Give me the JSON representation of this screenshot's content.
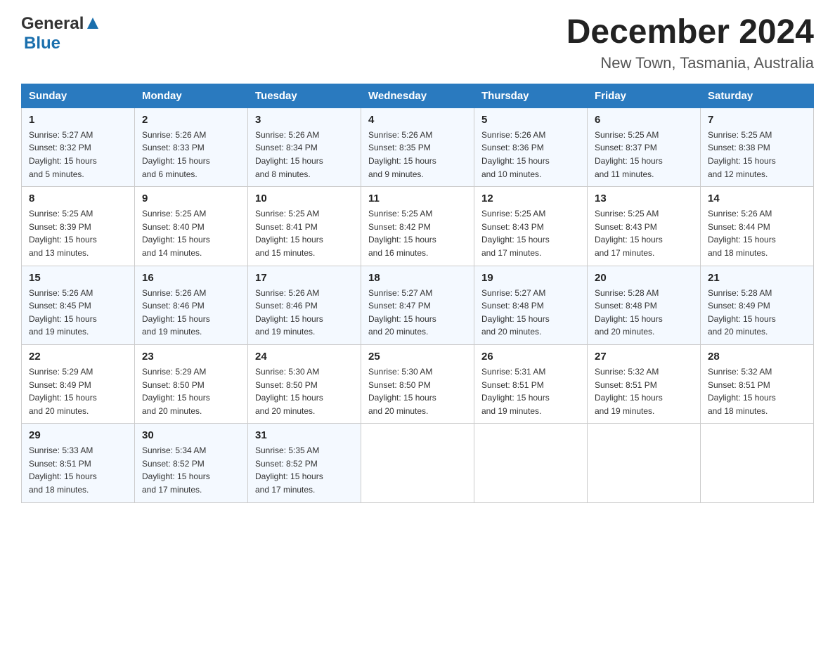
{
  "header": {
    "logo_general": "General",
    "logo_blue": "Blue",
    "month_title": "December 2024",
    "location": "New Town, Tasmania, Australia"
  },
  "days_of_week": [
    "Sunday",
    "Monday",
    "Tuesday",
    "Wednesday",
    "Thursday",
    "Friday",
    "Saturday"
  ],
  "weeks": [
    [
      {
        "day": "1",
        "sunrise": "5:27 AM",
        "sunset": "8:32 PM",
        "daylight": "15 hours and 5 minutes."
      },
      {
        "day": "2",
        "sunrise": "5:26 AM",
        "sunset": "8:33 PM",
        "daylight": "15 hours and 6 minutes."
      },
      {
        "day": "3",
        "sunrise": "5:26 AM",
        "sunset": "8:34 PM",
        "daylight": "15 hours and 8 minutes."
      },
      {
        "day": "4",
        "sunrise": "5:26 AM",
        "sunset": "8:35 PM",
        "daylight": "15 hours and 9 minutes."
      },
      {
        "day": "5",
        "sunrise": "5:26 AM",
        "sunset": "8:36 PM",
        "daylight": "15 hours and 10 minutes."
      },
      {
        "day": "6",
        "sunrise": "5:25 AM",
        "sunset": "8:37 PM",
        "daylight": "15 hours and 11 minutes."
      },
      {
        "day": "7",
        "sunrise": "5:25 AM",
        "sunset": "8:38 PM",
        "daylight": "15 hours and 12 minutes."
      }
    ],
    [
      {
        "day": "8",
        "sunrise": "5:25 AM",
        "sunset": "8:39 PM",
        "daylight": "15 hours and 13 minutes."
      },
      {
        "day": "9",
        "sunrise": "5:25 AM",
        "sunset": "8:40 PM",
        "daylight": "15 hours and 14 minutes."
      },
      {
        "day": "10",
        "sunrise": "5:25 AM",
        "sunset": "8:41 PM",
        "daylight": "15 hours and 15 minutes."
      },
      {
        "day": "11",
        "sunrise": "5:25 AM",
        "sunset": "8:42 PM",
        "daylight": "15 hours and 16 minutes."
      },
      {
        "day": "12",
        "sunrise": "5:25 AM",
        "sunset": "8:43 PM",
        "daylight": "15 hours and 17 minutes."
      },
      {
        "day": "13",
        "sunrise": "5:25 AM",
        "sunset": "8:43 PM",
        "daylight": "15 hours and 17 minutes."
      },
      {
        "day": "14",
        "sunrise": "5:26 AM",
        "sunset": "8:44 PM",
        "daylight": "15 hours and 18 minutes."
      }
    ],
    [
      {
        "day": "15",
        "sunrise": "5:26 AM",
        "sunset": "8:45 PM",
        "daylight": "15 hours and 19 minutes."
      },
      {
        "day": "16",
        "sunrise": "5:26 AM",
        "sunset": "8:46 PM",
        "daylight": "15 hours and 19 minutes."
      },
      {
        "day": "17",
        "sunrise": "5:26 AM",
        "sunset": "8:46 PM",
        "daylight": "15 hours and 19 minutes."
      },
      {
        "day": "18",
        "sunrise": "5:27 AM",
        "sunset": "8:47 PM",
        "daylight": "15 hours and 20 minutes."
      },
      {
        "day": "19",
        "sunrise": "5:27 AM",
        "sunset": "8:48 PM",
        "daylight": "15 hours and 20 minutes."
      },
      {
        "day": "20",
        "sunrise": "5:28 AM",
        "sunset": "8:48 PM",
        "daylight": "15 hours and 20 minutes."
      },
      {
        "day": "21",
        "sunrise": "5:28 AM",
        "sunset": "8:49 PM",
        "daylight": "15 hours and 20 minutes."
      }
    ],
    [
      {
        "day": "22",
        "sunrise": "5:29 AM",
        "sunset": "8:49 PM",
        "daylight": "15 hours and 20 minutes."
      },
      {
        "day": "23",
        "sunrise": "5:29 AM",
        "sunset": "8:50 PM",
        "daylight": "15 hours and 20 minutes."
      },
      {
        "day": "24",
        "sunrise": "5:30 AM",
        "sunset": "8:50 PM",
        "daylight": "15 hours and 20 minutes."
      },
      {
        "day": "25",
        "sunrise": "5:30 AM",
        "sunset": "8:50 PM",
        "daylight": "15 hours and 20 minutes."
      },
      {
        "day": "26",
        "sunrise": "5:31 AM",
        "sunset": "8:51 PM",
        "daylight": "15 hours and 19 minutes."
      },
      {
        "day": "27",
        "sunrise": "5:32 AM",
        "sunset": "8:51 PM",
        "daylight": "15 hours and 19 minutes."
      },
      {
        "day": "28",
        "sunrise": "5:32 AM",
        "sunset": "8:51 PM",
        "daylight": "15 hours and 18 minutes."
      }
    ],
    [
      {
        "day": "29",
        "sunrise": "5:33 AM",
        "sunset": "8:51 PM",
        "daylight": "15 hours and 18 minutes."
      },
      {
        "day": "30",
        "sunrise": "5:34 AM",
        "sunset": "8:52 PM",
        "daylight": "15 hours and 17 minutes."
      },
      {
        "day": "31",
        "sunrise": "5:35 AM",
        "sunset": "8:52 PM",
        "daylight": "15 hours and 17 minutes."
      },
      null,
      null,
      null,
      null
    ]
  ],
  "labels": {
    "sunrise": "Sunrise:",
    "sunset": "Sunset:",
    "daylight": "Daylight:"
  }
}
